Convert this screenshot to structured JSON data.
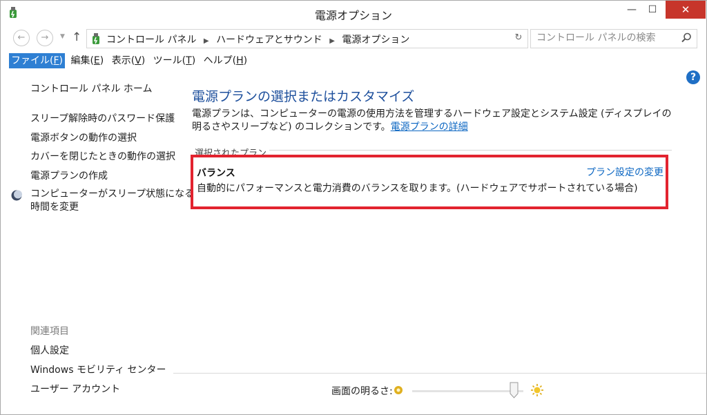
{
  "window": {
    "title": "電源オプション",
    "close_glyph": "✕",
    "max_glyph": "☐",
    "min_glyph": "—"
  },
  "nav": {
    "back_glyph": "←",
    "forward_glyph": "→",
    "dropdown_glyph": "▼",
    "up_glyph": "↑",
    "refresh_glyph": "↻",
    "breadcrumbs": [
      "コントロール パネル",
      "ハードウェアとサウンド",
      "電源オプション"
    ],
    "separator_glyph": "▶"
  },
  "search": {
    "placeholder": "コントロール パネルの検索"
  },
  "menu": {
    "file": {
      "label": "ファイル(",
      "key": "F",
      "end": ")"
    },
    "edit": {
      "label": "編集(",
      "key": "E",
      "end": ")"
    },
    "view": {
      "label": "表示(",
      "key": "V",
      "end": ")"
    },
    "tools": {
      "label": "ツール(",
      "key": "T",
      "end": ")"
    },
    "help": {
      "label": "ヘルプ(",
      "key": "H",
      "end": ")"
    }
  },
  "help_button": "?",
  "sidebar": {
    "home": "コントロール パネル ホーム",
    "links": [
      "スリープ解除時のパスワード保護",
      "電源ボタンの動作の選択",
      "カバーを閉じたときの動作の選択",
      "電源プランの作成"
    ],
    "sleep_link_line1": "コンピューターがスリープ状態になる",
    "sleep_link_line2": "時間を変更",
    "related_title": "関連項目",
    "related": [
      "個人設定",
      "Windows モビリティ センター",
      "ユーザー アカウント"
    ]
  },
  "main": {
    "title": "電源プランの選択またはカスタマイズ",
    "description": "電源プランは、コンピューターの電源の使用方法を管理するハードウェア設定とシステム設定 (ディスプレイの明るさやスリープなど) のコレクションです。",
    "description_link": "電源プランの詳細",
    "selected_plan_label": "選択されたプラン",
    "plan": {
      "name": "バランス",
      "description": "自動的にパフォーマンスと電力消費のバランスを取ります。(ハードウェアでサポートされている場合)",
      "change_link": "プラン設定の変更"
    }
  },
  "brightness": {
    "label": "画面の明るさ:",
    "level_percent": 95
  },
  "colors": {
    "title_blue": "#1d4f9c",
    "link_blue": "#0b66c2",
    "highlight_red": "#e2232f",
    "close_red": "#c7352b",
    "menu_active": "#2e7fd3"
  }
}
